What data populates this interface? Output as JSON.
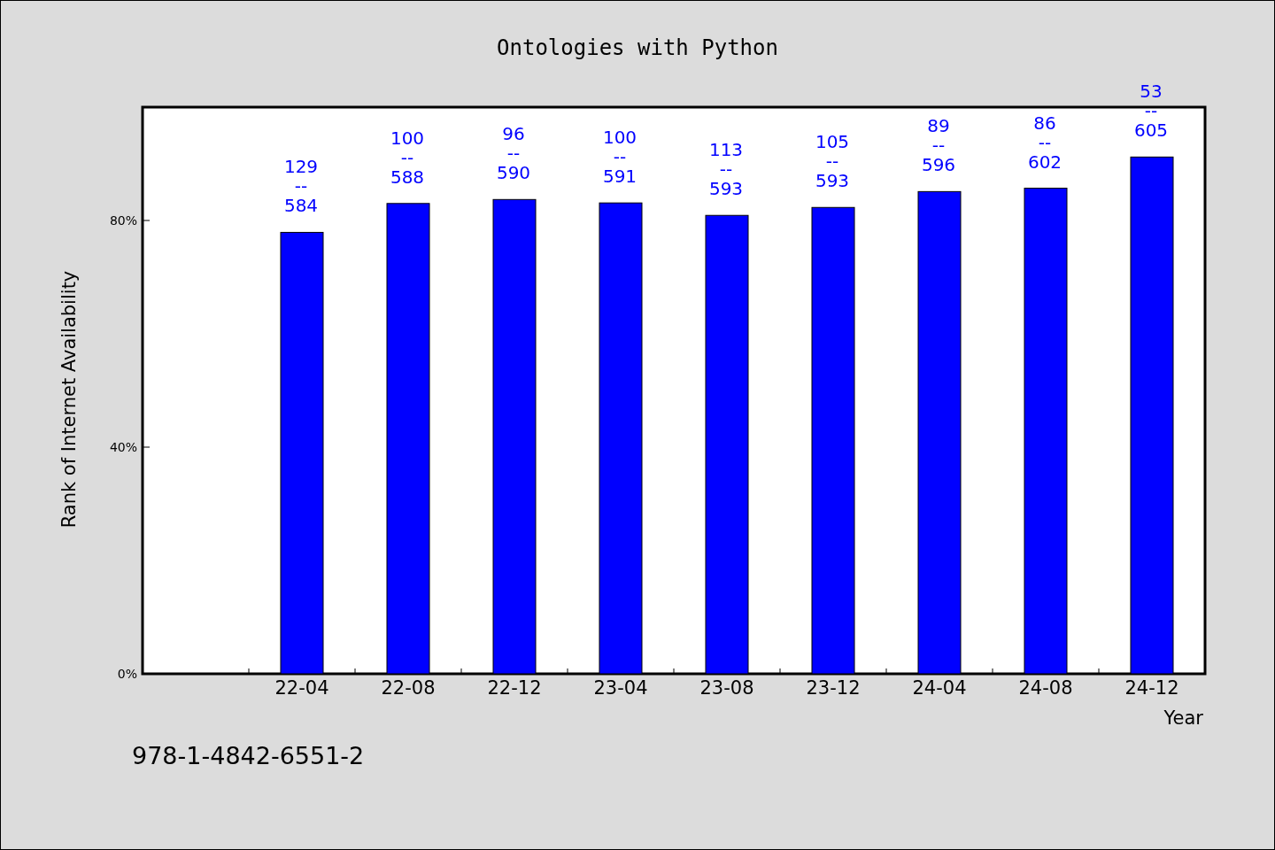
{
  "chart_data": {
    "type": "bar",
    "title": "Ontologies with Python",
    "xlabel": "Year",
    "ylabel": "Rank of Internet Availability",
    "categories": [
      "22-04",
      "22-08",
      "22-12",
      "23-04",
      "23-08",
      "23-12",
      "24-04",
      "24-08",
      "24-12"
    ],
    "series": [
      {
        "color": "#0000ff",
        "values": [
          77.9,
          83.0,
          83.7,
          83.1,
          80.9,
          82.3,
          85.1,
          85.7,
          91.2
        ]
      }
    ],
    "ylim": [
      0,
      100
    ],
    "yticks": [
      {
        "value": 0,
        "label": "0%"
      },
      {
        "value": 40,
        "label": "40%"
      },
      {
        "value": 80,
        "label": "80%"
      }
    ],
    "value_labels": [
      [
        "129",
        "--",
        "584"
      ],
      [
        "100",
        "--",
        "588"
      ],
      [
        "96",
        "--",
        "590"
      ],
      [
        "100",
        "--",
        "591"
      ],
      [
        "113",
        "--",
        "593"
      ],
      [
        "105",
        "--",
        "593"
      ],
      [
        "89",
        "--",
        "596"
      ],
      [
        "86",
        "--",
        "602"
      ],
      [
        "53",
        "--",
        "605"
      ]
    ]
  },
  "footer": "978-1-4842-6551-2"
}
